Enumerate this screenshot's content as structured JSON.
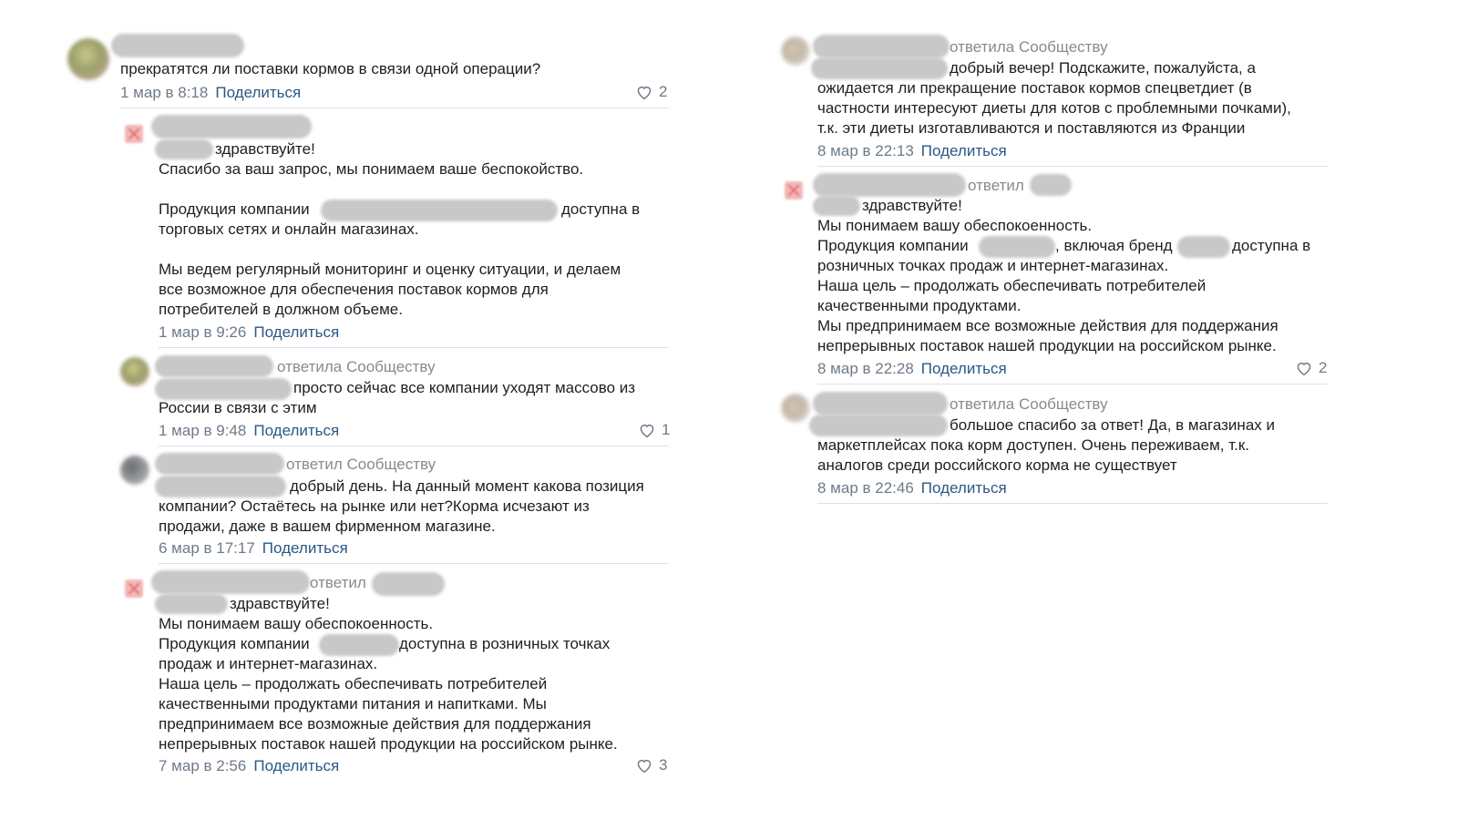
{
  "share_label": "Поделиться",
  "colors": {
    "link": "#2a5885",
    "meta": "#6e7a88",
    "separator": "#dce1e6",
    "reply_to": "#8a8a8a"
  },
  "left_column": [
    {
      "text": "прекратятся ли поставки кормов в связи одной операции?",
      "date": "1 мар в 8:18",
      "likes": "2"
    },
    {
      "greeting": "здравствуйте!",
      "p1": "Спасибо за ваш запрос, мы понимаем ваше беспокойство.",
      "p2a": "Продукция компании",
      "p2b": "доступна в",
      "p2c": "торговых сетях и онлайн магазинах.",
      "p3": "Мы ведем регулярный мониторинг и оценку ситуации, и делаем\nвсе возможное для обеспечения поставок кормов для\nпотребителей в должном объеме.",
      "date": "1 мар в 9:26"
    },
    {
      "reply_to": "ответила Сообществу",
      "line1": "просто сейчас все компании уходят массово из",
      "line2": "России в связи с этим",
      "date": "1 мар в 9:48",
      "likes": "1"
    },
    {
      "reply_to": "ответил Сообществу",
      "line1": "добрый день. На данный момент какова позиция",
      "rest": "компании? Остаётесь на рынке или нет?Корма исчезают из\nпродажи, даже в вашем фирменном магазине.",
      "date": "6 мар в 17:17"
    },
    {
      "reply_to": "ответил",
      "greeting": "здравствуйте!",
      "l1": "Мы понимаем вашу обеспокоенность.",
      "l2a": "Продукция компании",
      "l2b": "доступна в розничных точках",
      "rest": "продаж и интернет-магазинах.\nНаша цель – продолжать обеспечивать потребителей\nкачественными продуктами питания и напитками. Мы\nпредпринимаем все возможные действия для поддержания\nнепрерывных поставок нашей продукции на российском рынке.",
      "date": "7 мар в 2:56",
      "likes": "3"
    }
  ],
  "right_column": [
    {
      "reply_to": "ответила Сообществу",
      "line1": "добрый вечер! Подскажите, пожалуйста, а",
      "rest": "ожидается ли прекращение поставок кормов спецветдиет (в\nчастности интересуют диеты для котов с проблемными почками),\nт.к. эти диеты изготавливаются и поставляются из Франции",
      "date": "8 мар в 22:13"
    },
    {
      "reply_to": "ответил",
      "greeting": "здравствуйте!",
      "l1": "Мы понимаем вашу обеспокоенность.",
      "l2a": "Продукция компании",
      "l2b": ", включая бренд",
      "l2c": "доступна в",
      "rest": "розничных точках продаж и интернет-магазинах.\nНаша цель – продолжать обеспечивать потребителей\nкачественными продуктами.\nМы предпринимаем все возможные действия для поддержания\nнепрерывных поставок нашей продукции на российском рынке.",
      "date": "8 мар в 22:28",
      "likes": "2"
    },
    {
      "reply_to": "ответила Сообществу",
      "line1": "большое спасибо за ответ! Да, в магазинах и",
      "rest": "маркетплейсах пока корм доступен. Очень переживаем, т.к.\nаналогов среди российского корма не существует",
      "date": "8 мар в 22:46"
    }
  ]
}
